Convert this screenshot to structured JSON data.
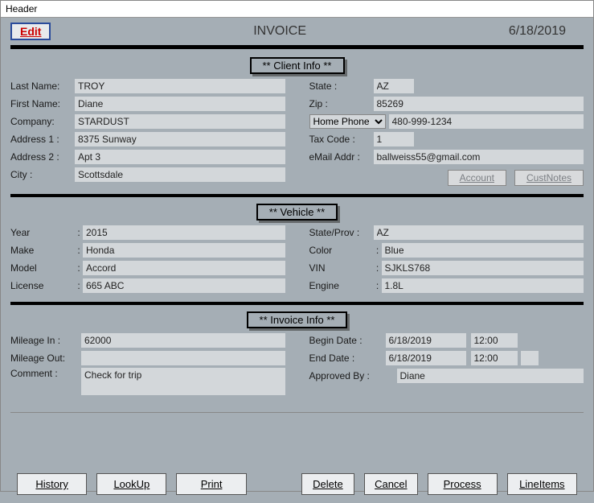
{
  "window": {
    "title": "Header"
  },
  "header": {
    "edit": "Edit",
    "title": "INVOICE",
    "date": "6/18/2019"
  },
  "sections": {
    "client": "** Client Info **",
    "vehicle": "**  Vehicle  **",
    "invoice": "** Invoice Info  **"
  },
  "labels": {
    "lastName": "Last Name:",
    "firstName": "First Name:",
    "company": "Company:",
    "address1": "Address 1 :",
    "address2": "Address 2 :",
    "city": "City :",
    "state": "State :",
    "zip": "Zip :",
    "phoneType": "Home Phone",
    "taxCode": "Tax Code :",
    "email": "eMail Addr :",
    "year": "Year",
    "make": "Make",
    "model": "Model",
    "license": "License",
    "stateProv": "State/Prov :",
    "color": "Color",
    "vin": "VIN",
    "engine": "Engine",
    "mileageIn": "Mileage In :",
    "mileageOut": "Mileage Out:",
    "comment": "Comment :",
    "beginDate": "Begin Date :",
    "endDate": "End Date :",
    "approvedBy": "Approved By :"
  },
  "client": {
    "lastName": "TROY",
    "firstName": "Diane",
    "company": "STARDUST",
    "address1": "8375 Sunway",
    "address2": "Apt 3",
    "city": "Scottsdale",
    "state": "AZ",
    "zip": "85269",
    "phone": "480-999-1234",
    "taxCode": "1",
    "email": "ballweiss55@gmail.com"
  },
  "buttons": {
    "account": "Account",
    "custnotes": "CustNotes"
  },
  "vehicle": {
    "year": "2015",
    "make": "Honda",
    "model": "Accord",
    "license": "665 ABC",
    "stateProv": "AZ",
    "color": "Blue",
    "vin": "SJKLS768",
    "engine": "1.8L"
  },
  "invoice": {
    "mileageIn": "62000",
    "mileageOut": "",
    "comment": "Check for trip",
    "beginDate": "6/18/2019",
    "beginTime": "12:00",
    "endDate": "6/18/2019",
    "endTime": "12:00",
    "approvedBy": "Diane"
  },
  "footer": {
    "history": "History",
    "lookup": "LookUp",
    "print": "Print",
    "delete": "Delete",
    "cancel": "Cancel",
    "process": "Process",
    "lineitems": "LineItems"
  }
}
